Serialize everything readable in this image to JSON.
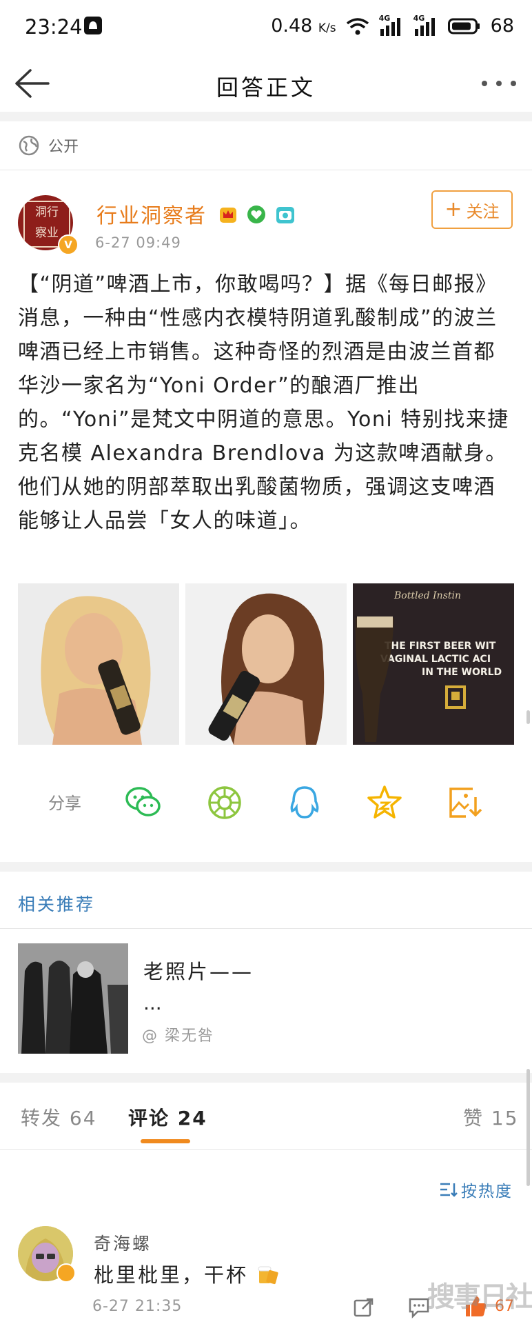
{
  "status_bar": {
    "time": "23:24",
    "speed": "0.48",
    "speed_unit": "K/s",
    "network1": "4G",
    "network2": "4G",
    "battery": "68"
  },
  "nav": {
    "title": "回答正文"
  },
  "post": {
    "visibility": "公开",
    "author": "行业洞察者",
    "avatar_text": [
      "洞",
      "行",
      "察",
      "业"
    ],
    "timestamp": "6-27 09:49",
    "follow_label": "关注",
    "body": "【“阴道”啤酒上市，你敢喝吗？】据《每日邮报》消息，一种由“性感内衣模特阴道乳酸制成”的波兰啤酒已经上市销售。这种奇怪的烈酒是由波兰首都华沙一家名为“Yoni Order”的酿酒厂推出的。“Yoni”是梵文中阴道的意思。Yoni 特别找来捷克名模 Alexandra Brendlova 为这款啤酒献身。他们从她的阴部萃取出乳酸菌物质，强调这支啤酒能够让人品尝「女人的味道」。",
    "ad_text_1": "Bottled Instin",
    "ad_text_2": "THE FIRST BEER WIT",
    "ad_text_3": "VAGINAL LACTIC ACI",
    "ad_text_4": "IN THE WORLD"
  },
  "share": {
    "label": "分享",
    "icons": [
      "wechat-icon",
      "moments-icon",
      "qq-icon",
      "qzone-icon",
      "save-image-icon"
    ]
  },
  "recommend": {
    "title": "相关推荐",
    "item_text": "老照片——",
    "item_ellipsis": "...",
    "item_author": "@ 梁无咎"
  },
  "tabs": {
    "repost_label": "转发",
    "repost_count": "64",
    "comment_label": "评论",
    "comment_count": "24",
    "like_label": "赞",
    "like_count": "15"
  },
  "sort_label": "按热度",
  "comment": {
    "name": "奇海螺",
    "text": "枇里枇里，干杯",
    "time": "6-27 21:35",
    "likes": "67"
  },
  "watermark": "搜事日社",
  "colors": {
    "accent": "#f08a1e",
    "link": "#3a7db8",
    "username": "#e77b1a"
  }
}
